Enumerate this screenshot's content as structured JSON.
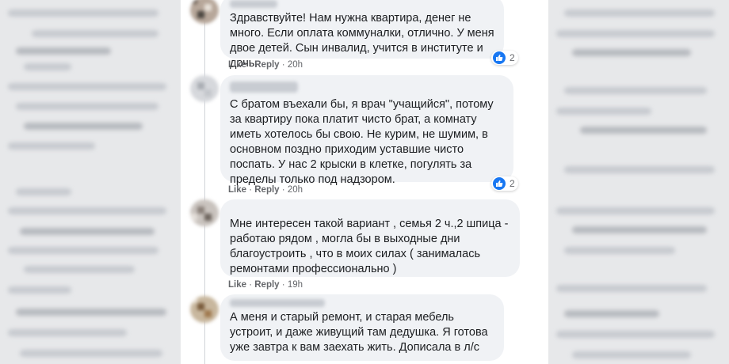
{
  "comments": [
    {
      "text": "Здравствуйте! Нам нужна квартира, денег не много. Если оплата коммуналки, отлично. У меня двое детей. Сын инвалид, учится в институте и дочь.",
      "like": "Like",
      "reply": "Reply",
      "time": "20h",
      "reactions": "2"
    },
    {
      "text": "С братом въехали бы, я врач \"учащийся\", потому за квартиру пока платит чисто брат, а комнату иметь хотелось бы свою. Не курим, не шумим, в основном поздно приходим уставшие чисто поспать. У нас 2 крыски в клетке, погулять за пределы только под надзором.",
      "like": "Like",
      "reply": "Reply",
      "time": "20h",
      "reactions": "2"
    },
    {
      "text": "Мне интересен такой вариант , семья 2 ч.,2 шпица - работаю рядом , могла бы в выходные дни благоустроить , что в моих силах ( занималась ремонтами профессионально )",
      "like": "Like",
      "reply": "Reply",
      "time": "19h"
    },
    {
      "text": "А меня и старый ремонт, и старая мебель устроит, и даже живущий там дедушка. Я готова уже завтра к вам заехать жить. Дописала в л/с"
    }
  ],
  "colors": {
    "accent": "#1877f2",
    "bubble": "#f0f2f5",
    "meta": "#65676b"
  },
  "icons": {
    "reaction": "thumbs-up-icon"
  }
}
